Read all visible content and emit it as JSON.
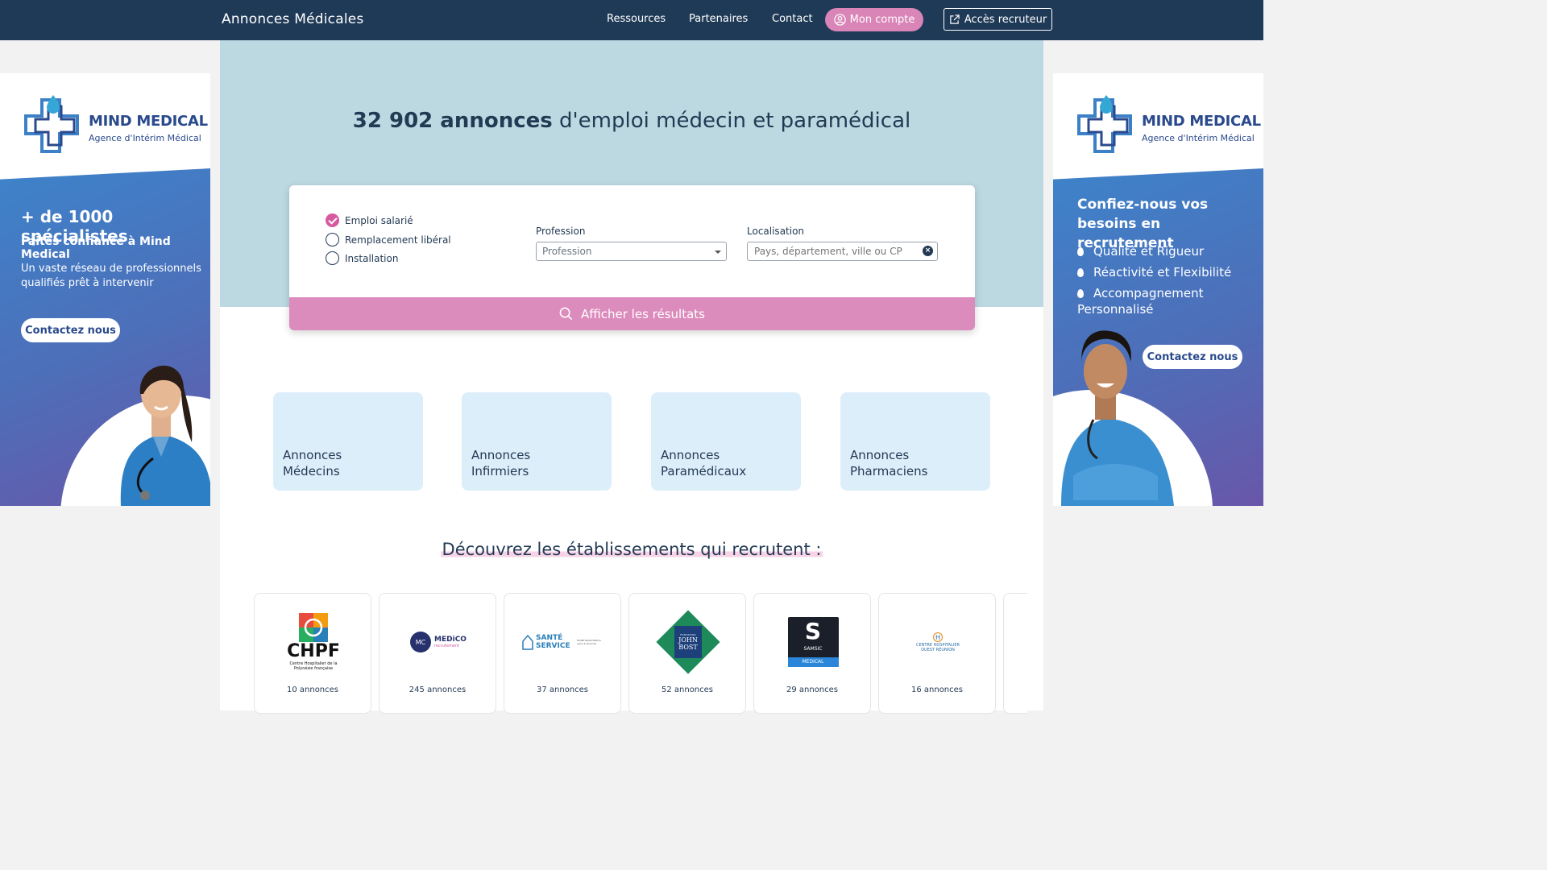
{
  "header": {
    "logo": "Annonces Médicales",
    "nav": [
      "Ressources",
      "Partenaires",
      "Contact"
    ],
    "account_label": "Mon compte",
    "recruiter_label": "Accès recruteur"
  },
  "hero": {
    "title_bold": "32 902 annonces",
    "title_rest": " d'emploi médecin et paramédical"
  },
  "search": {
    "options": [
      {
        "label": "Emploi salarié",
        "checked": true
      },
      {
        "label": "Remplacement libéral",
        "checked": false
      },
      {
        "label": "Installation",
        "checked": false
      }
    ],
    "profession_label": "Profession",
    "profession_value": "Profession",
    "location_label": "Localisation",
    "location_placeholder": "Pays, département, ville ou CP",
    "submit_label": "Afficher les résultats"
  },
  "categories": [
    {
      "line1": "Annonces",
      "line2": "Médecins"
    },
    {
      "line1": "Annonces",
      "line2": "Infirmiers"
    },
    {
      "line1": "Annonces",
      "line2": "Paramédicaux"
    },
    {
      "line1": "Annonces",
      "line2": "Pharmaciens"
    }
  ],
  "establishments": {
    "title": "Découvrez les établissements qui recrutent :",
    "items": [
      {
        "logo_text": "CHPF",
        "logo_sub": "Centre Hospitalier de la Polynésie française",
        "count": "10 annonces"
      },
      {
        "logo_text": "MEDiCO",
        "logo_sub": "recrutement",
        "count": "245 annonces"
      },
      {
        "logo_text": "SANTÉ SERVICE",
        "logo_sub": "HOSPITALISATION & soins à domicile",
        "count": "37 annonces"
      },
      {
        "logo_text": "JOHN BOST",
        "logo_sub": "FONDATION",
        "count": "52 annonces"
      },
      {
        "logo_text": "S",
        "logo_sub": "SAMSIC",
        "logo_tag": "MEDICAL",
        "count": "29 annonces"
      },
      {
        "logo_text": "CENTRE HOSPITALIER",
        "logo_sub": "OUEST RÉUNION",
        "count": "16 annonces"
      }
    ]
  },
  "banner_left": {
    "brand": "MIND MEDICAL",
    "sub": "Agence d'Intérim Médical",
    "headline": "+ de 1000 spécialistes",
    "subheadline": "Faites confiance à Mind Medical",
    "text": "Un vaste réseau de professionnels qualifiés prêt à intervenir",
    "cta": "Contactez nous"
  },
  "banner_right": {
    "brand": "MIND MEDICAL",
    "sub": "Agence d'Intérim Médical",
    "headline": "Confiez-nous vos besoins en recrutement",
    "bullets": [
      "Qualité et Rigueur",
      "Réactivité et Flexibilité",
      "Accompagnement Personnalisé"
    ],
    "cta": "Contactez nous"
  },
  "colors": {
    "navy": "#1f3a57",
    "pink": "#d985b7",
    "hero_bg": "#bcd9e2",
    "card_bg": "#ddeefb"
  }
}
